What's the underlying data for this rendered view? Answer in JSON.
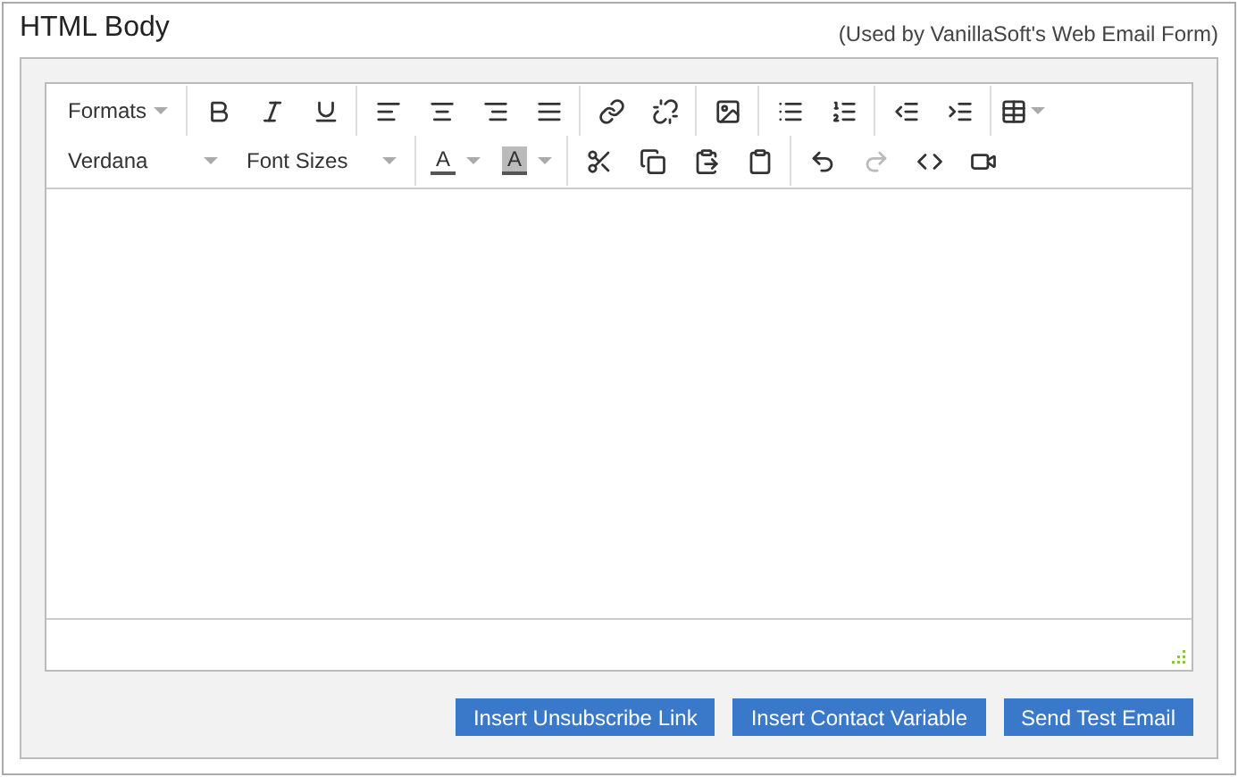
{
  "panel": {
    "title": "HTML Body",
    "note": "(Used by VanillaSoft's Web Email Form)"
  },
  "toolbar": {
    "rows": [
      [
        [
          {
            "kind": "dropdown",
            "label": "Formats",
            "disabled": false
          }
        ],
        [
          {
            "kind": "bold",
            "disabled": false
          },
          {
            "kind": "italic",
            "disabled": false
          },
          {
            "kind": "underline",
            "disabled": false
          }
        ],
        [
          {
            "kind": "align-left",
            "disabled": false
          },
          {
            "kind": "align-center",
            "disabled": false
          },
          {
            "kind": "align-right",
            "disabled": false
          },
          {
            "kind": "align-justify",
            "disabled": false
          }
        ],
        [
          {
            "kind": "link",
            "disabled": false
          },
          {
            "kind": "unlink",
            "disabled": false
          }
        ],
        [
          {
            "kind": "image",
            "disabled": false
          }
        ],
        [
          {
            "kind": "bullet-list",
            "disabled": false
          },
          {
            "kind": "numbered-list",
            "disabled": false
          }
        ],
        [
          {
            "kind": "outdent",
            "disabled": false
          },
          {
            "kind": "indent",
            "disabled": false
          }
        ],
        [
          {
            "kind": "table",
            "disabled": false
          }
        ]
      ],
      [
        [
          {
            "kind": "dropdown",
            "label": "Verdana",
            "disabled": false
          },
          {
            "kind": "dropdown",
            "label": "Font Sizes",
            "disabled": false
          }
        ],
        [
          {
            "kind": "text-color",
            "label": "A",
            "disabled": false
          },
          {
            "kind": "background-color",
            "label": "A",
            "disabled": false
          }
        ],
        [
          {
            "kind": "cut",
            "disabled": false
          },
          {
            "kind": "copy",
            "disabled": false
          },
          {
            "kind": "paste",
            "disabled": false
          },
          {
            "kind": "paste-text",
            "disabled": false
          }
        ],
        [
          {
            "kind": "undo",
            "disabled": false
          },
          {
            "kind": "redo",
            "disabled": true
          },
          {
            "kind": "code",
            "disabled": false
          },
          {
            "kind": "video",
            "disabled": false
          }
        ]
      ]
    ]
  },
  "buttons": [
    "Insert Unsubscribe Link",
    "Insert Contact Variable",
    "Send Test Email"
  ]
}
